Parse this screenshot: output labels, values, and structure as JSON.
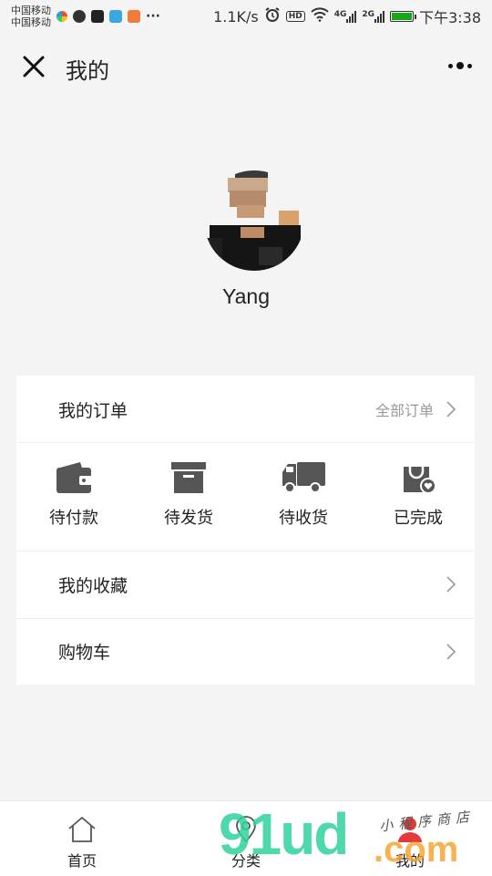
{
  "status_bar": {
    "carrier_1": "中国移动",
    "carrier_2": "中国移动",
    "overflow": "···",
    "net_speed": "1.1K/s",
    "hd": "HD",
    "net_4g": "4G",
    "net_2g": "2G",
    "time": "下午3:38",
    "battery_color": "#1ea51e"
  },
  "nav": {
    "title": "我的"
  },
  "profile": {
    "name": "Yang"
  },
  "orders": {
    "title": "我的订单",
    "all_label": "全部订单",
    "items": [
      {
        "label": "待付款",
        "icon": "wallet-icon"
      },
      {
        "label": "待发货",
        "icon": "box-icon"
      },
      {
        "label": "待收货",
        "icon": "truck-icon"
      },
      {
        "label": "已完成",
        "icon": "bag-check-icon"
      }
    ]
  },
  "menu": {
    "favorites": "我的收藏",
    "cart": "购物车"
  },
  "tabbar": {
    "items": [
      {
        "label": "首页",
        "icon": "home-icon"
      },
      {
        "label": "分类",
        "icon": "location-icon"
      },
      {
        "label": "我的",
        "icon": "user-icon"
      }
    ]
  },
  "watermark": {
    "logo": "91ud",
    "suffix": ".com",
    "script": "小程序商店"
  }
}
